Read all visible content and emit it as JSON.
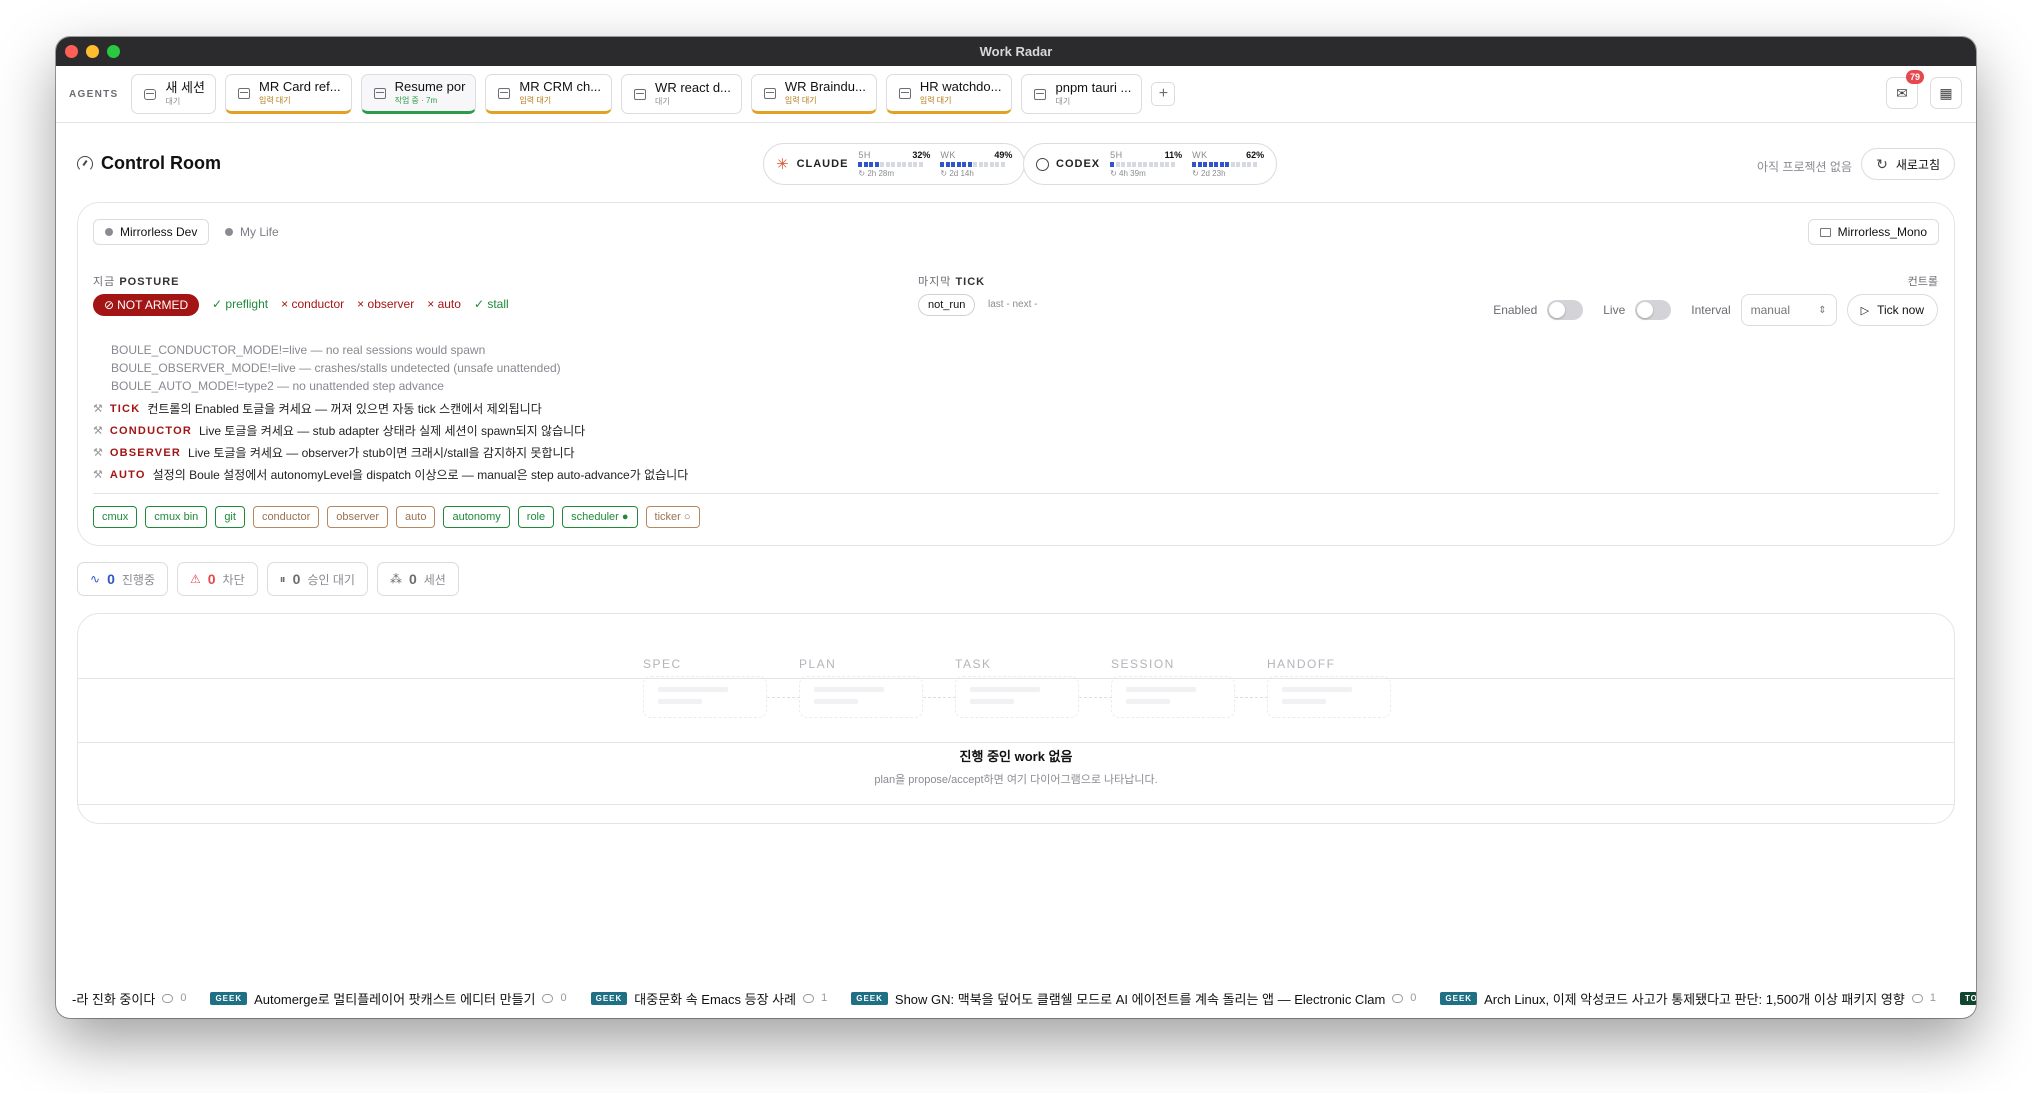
{
  "window": {
    "title": "Work Radar"
  },
  "agents": {
    "label": "AGENTS",
    "tabs": [
      {
        "title": "새 세션",
        "status": "대기",
        "kind": "chat",
        "state": "idle"
      },
      {
        "title": "MR Card ref...",
        "status": "입력 대기",
        "kind": "task",
        "state": "waiting"
      },
      {
        "title": "Resume por",
        "status": "작업 중 · 7m",
        "kind": "task",
        "state": "active"
      },
      {
        "title": "MR CRM ch...",
        "status": "입력 대기",
        "kind": "task",
        "state": "waiting"
      },
      {
        "title": "WR react d...",
        "status": "대기",
        "kind": "task",
        "state": "idle"
      },
      {
        "title": "WR Braindu...",
        "status": "입력 대기",
        "kind": "task",
        "state": "waiting"
      },
      {
        "title": "HR watchdo...",
        "status": "입력 대기",
        "kind": "task",
        "state": "waiting"
      },
      {
        "title": "pnpm tauri ...",
        "status": "대기",
        "kind": "task",
        "state": "idle"
      }
    ],
    "add_label": "+",
    "inbox_badge": "79"
  },
  "header": {
    "title": "Control Room",
    "no_project": "아직 프로젝션 없음",
    "refresh_label": "새로고침"
  },
  "quotas": [
    {
      "name": "CLAUDE",
      "short": {
        "label": "5H",
        "pct": "32%",
        "fill": 0.32,
        "reset": "↻ 2h 28m"
      },
      "week": {
        "label": "WK",
        "pct": "49%",
        "fill": 0.49,
        "reset": "↻ 2d 14h"
      }
    },
    {
      "name": "CODEX",
      "short": {
        "label": "5H",
        "pct": "11%",
        "fill": 0.11,
        "reset": "↻ 4h 39m"
      },
      "week": {
        "label": "WK",
        "pct": "62%",
        "fill": 0.62,
        "reset": "↻ 2d 23h"
      }
    }
  ],
  "workspaces": {
    "active": "Mirrorless Dev",
    "other": "My Life",
    "repo": "Mirrorless_Mono"
  },
  "posture": {
    "label_prefix": "지금",
    "label": "POSTURE",
    "status": "NOT ARMED",
    "checks": [
      {
        "name": "preflight",
        "ok": true,
        "mark": "✓"
      },
      {
        "name": "conductor",
        "ok": false,
        "mark": "×"
      },
      {
        "name": "observer",
        "ok": false,
        "mark": "×"
      },
      {
        "name": "auto",
        "ok": false,
        "mark": "×"
      },
      {
        "name": "stall",
        "ok": true,
        "mark": "✓"
      }
    ],
    "env_lines": [
      "BOULE_CONDUCTOR_MODE!=live — no real sessions would spawn",
      "BOULE_OBSERVER_MODE!=live — crashes/stalls undetected (unsafe unattended)",
      "BOULE_AUTO_MODE!=type2 — no unattended step advance"
    ],
    "hints": [
      {
        "key": "TICK",
        "text": "컨트롤의 Enabled 토글을 켜세요 — 꺼져 있으면 자동 tick 스캔에서 제외됩니다"
      },
      {
        "key": "CONDUCTOR",
        "text": "Live 토글을 켜세요 — stub adapter 상태라 실제 세션이 spawn되지 않습니다"
      },
      {
        "key": "OBSERVER",
        "text": "Live 토글을 켜세요 — observer가 stub이면 크래시/stall을 감지하지 못합니다"
      },
      {
        "key": "AUTO",
        "text": "설정의 Boule 설정에서 autonomyLevel을 dispatch 이상으로 — manual은 step auto-advance가 없습니다"
      }
    ],
    "tags": [
      {
        "label": "cmux",
        "tone": "g"
      },
      {
        "label": "cmux bin",
        "tone": "g"
      },
      {
        "label": "git",
        "tone": "g"
      },
      {
        "label": "conductor",
        "tone": "w"
      },
      {
        "label": "observer",
        "tone": "w"
      },
      {
        "label": "auto",
        "tone": "w"
      },
      {
        "label": "autonomy",
        "tone": "g"
      },
      {
        "label": "role",
        "tone": "g"
      },
      {
        "label": "scheduler ●",
        "tone": "g"
      },
      {
        "label": "ticker ○",
        "tone": "w"
      }
    ]
  },
  "tick": {
    "label_prefix": "마지막",
    "label": "TICK",
    "status": "not_run",
    "sub": "last -   next -"
  },
  "controls": {
    "label": "컨트롤",
    "enabled_label": "Enabled",
    "live_label": "Live",
    "interval_label": "Interval",
    "interval_value": "manual",
    "tick_now_label": "Tick now"
  },
  "stats": [
    {
      "value": "0",
      "label": "진행중",
      "color": "#2f55c8",
      "icon": "activity-icon"
    },
    {
      "value": "0",
      "label": "차단",
      "color": "#e5484d",
      "icon": "warning-icon"
    },
    {
      "value": "0",
      "label": "승인 대기",
      "color": "#6b6b72",
      "icon": "pause-icon"
    },
    {
      "value": "0",
      "label": "세션",
      "color": "#6b6b72",
      "icon": "cluster-icon"
    }
  ],
  "pipeline": {
    "stages": [
      "SPEC",
      "PLAN",
      "TASK",
      "SESSION",
      "HANDOFF"
    ],
    "empty_title": "진행 중인 work 없음",
    "empty_sub": "plan을 propose/accept하면 여기 다이어그램으로 나타납니다."
  },
  "ticker": [
    {
      "badge": "",
      "text": "-라 진화 중이다",
      "comments": "0"
    },
    {
      "badge": "GEEK",
      "text": "Automerge로 멀티플레이어 팟캐스트 에디터 만들기",
      "comments": "0"
    },
    {
      "badge": "GEEK",
      "text": "대중문화 속 Emacs 등장 사례",
      "comments": "1"
    },
    {
      "badge": "GEEK",
      "text": "Show GN: 맥북을 덮어도 클램쉘 모드로 AI 에이전트를 계속 돌리는 앱 — Electronic Clam",
      "comments": "0"
    },
    {
      "badge": "GEEK",
      "text": "Arch Linux, 이제 악성코드 사고가 통제됐다고 판단: 1,500개 이상 패키지 영향",
      "comments": "1"
    },
    {
      "badge": "TOS",
      "text": "",
      "comments": ""
    }
  ],
  "colors": {
    "danger": "#a31515",
    "ok": "#1f8a3a",
    "accent": "#2f55c8",
    "waiting": "#e2a124"
  }
}
